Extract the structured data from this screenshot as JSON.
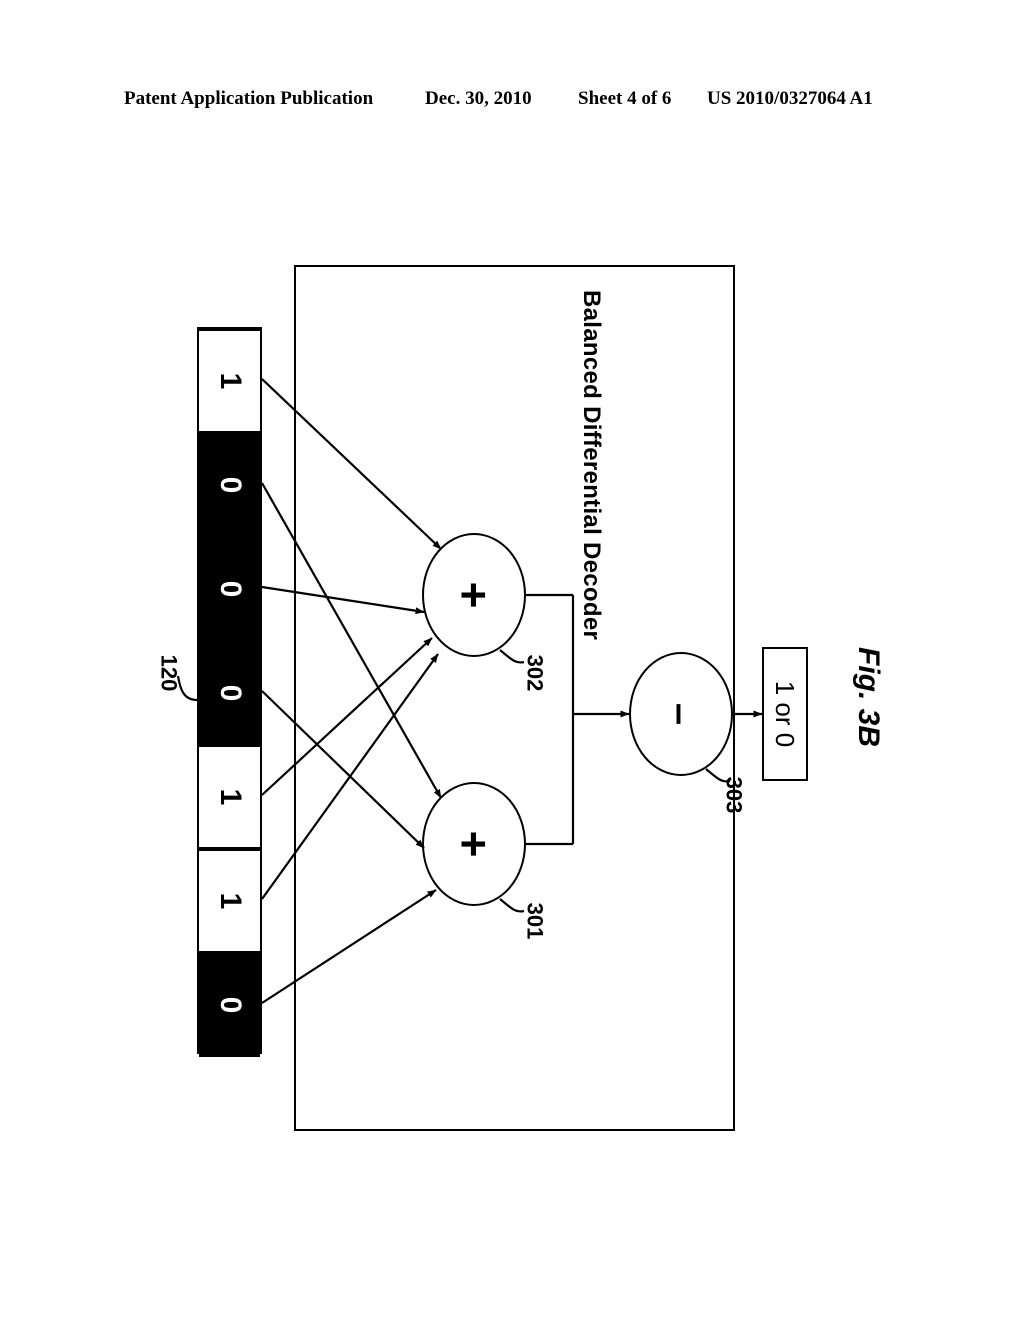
{
  "header": {
    "publication": "Patent Application Publication",
    "date": "Dec. 30, 2010",
    "sheet": "Sheet 4 of 6",
    "patent_number": "US 2010/0327064 A1"
  },
  "figure": {
    "caption": "Fig. 3B",
    "decoder": {
      "label": "Balanced Differential Decoder",
      "ref": "120"
    },
    "bit_column": {
      "ref_label": "120",
      "bits": [
        {
          "value": "1",
          "state": "one"
        },
        {
          "value": "0",
          "state": "zero"
        },
        {
          "value": "0",
          "state": "zero"
        },
        {
          "value": "0",
          "state": "zero"
        },
        {
          "value": "1",
          "state": "one"
        },
        {
          "value": "1",
          "state": "one"
        },
        {
          "value": "0",
          "state": "zero"
        }
      ]
    },
    "operators": [
      {
        "id": "302",
        "glyph": "+",
        "name": "adder-302"
      },
      {
        "id": "301",
        "glyph": "+",
        "name": "adder-301"
      },
      {
        "id": "303",
        "glyph": "–",
        "name": "subtractor-303"
      }
    ],
    "output": {
      "text": "1 or 0"
    }
  }
}
